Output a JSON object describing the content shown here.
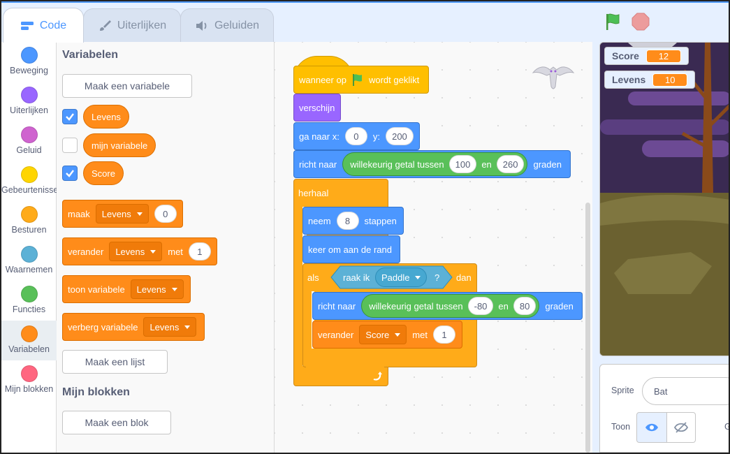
{
  "tabs": {
    "code": "Code",
    "costumes": "Uiterlijken",
    "sounds": "Geluiden"
  },
  "categories": [
    {
      "label": "Beweging",
      "color": "#4c97ff"
    },
    {
      "label": "Uiterlijken",
      "color": "#9966ff"
    },
    {
      "label": "Geluid",
      "color": "#cf63cf"
    },
    {
      "label": "Gebeurtenissen",
      "color": "#ffd500"
    },
    {
      "label": "Besturen",
      "color": "#ffab19"
    },
    {
      "label": "Waarnemen",
      "color": "#5cb1d6"
    },
    {
      "label": "Functies",
      "color": "#59c059"
    },
    {
      "label": "Variabelen",
      "color": "#ff8c1a"
    },
    {
      "label": "Mijn blokken",
      "color": "#ff6680"
    }
  ],
  "palette": {
    "title": "Variabelen",
    "make_variable": "Maak een variabele",
    "variables": [
      "Levens",
      "mijn variabele",
      "Score"
    ],
    "set_block": {
      "label": "maak",
      "var": "Levens",
      "value": "0"
    },
    "change_block": {
      "label": "verander",
      "var": "Levens",
      "met": "met",
      "value": "1"
    },
    "show_block": {
      "label": "toon variabele",
      "var": "Levens"
    },
    "hide_block": {
      "label": "verberg variabele",
      "var": "Levens"
    },
    "make_list": "Maak een lijst",
    "my_blocks_title": "Mijn blokken",
    "make_block": "Maak een blok"
  },
  "script": {
    "hat": {
      "pre": "wanneer op",
      "post": "wordt geklikt"
    },
    "show": "verschijn",
    "goto": {
      "label": "ga naar x:",
      "x": "0",
      "ylabel": "y:",
      "y": "200"
    },
    "point": {
      "label": "richt naar",
      "random": "willekeurig getal tussen",
      "a": "100",
      "en": "en",
      "b": "260",
      "unit": "graden"
    },
    "forever": "herhaal",
    "move": {
      "label": "neem",
      "steps": "8",
      "unit": "stappen"
    },
    "bounce": "keer om aan de rand",
    "if": {
      "label": "als",
      "touch": "raak ik",
      "target": "Paddle",
      "q": "?",
      "then": "dan"
    },
    "point2": {
      "label": "richt naar",
      "random": "willekeurig getal tussen",
      "a": "-80",
      "en": "en",
      "b": "80",
      "unit": "graden"
    },
    "change": {
      "label": "verander",
      "var": "Score",
      "met": "met",
      "value": "1"
    }
  },
  "stage": {
    "monitors": [
      {
        "name": "Score",
        "value": "12"
      },
      {
        "name": "Levens",
        "value": "10"
      }
    ]
  },
  "sprite_panel": {
    "sprite_label": "Sprite",
    "sprite_name": "Bat",
    "show_label": "Toon",
    "cut_letter": "G"
  }
}
